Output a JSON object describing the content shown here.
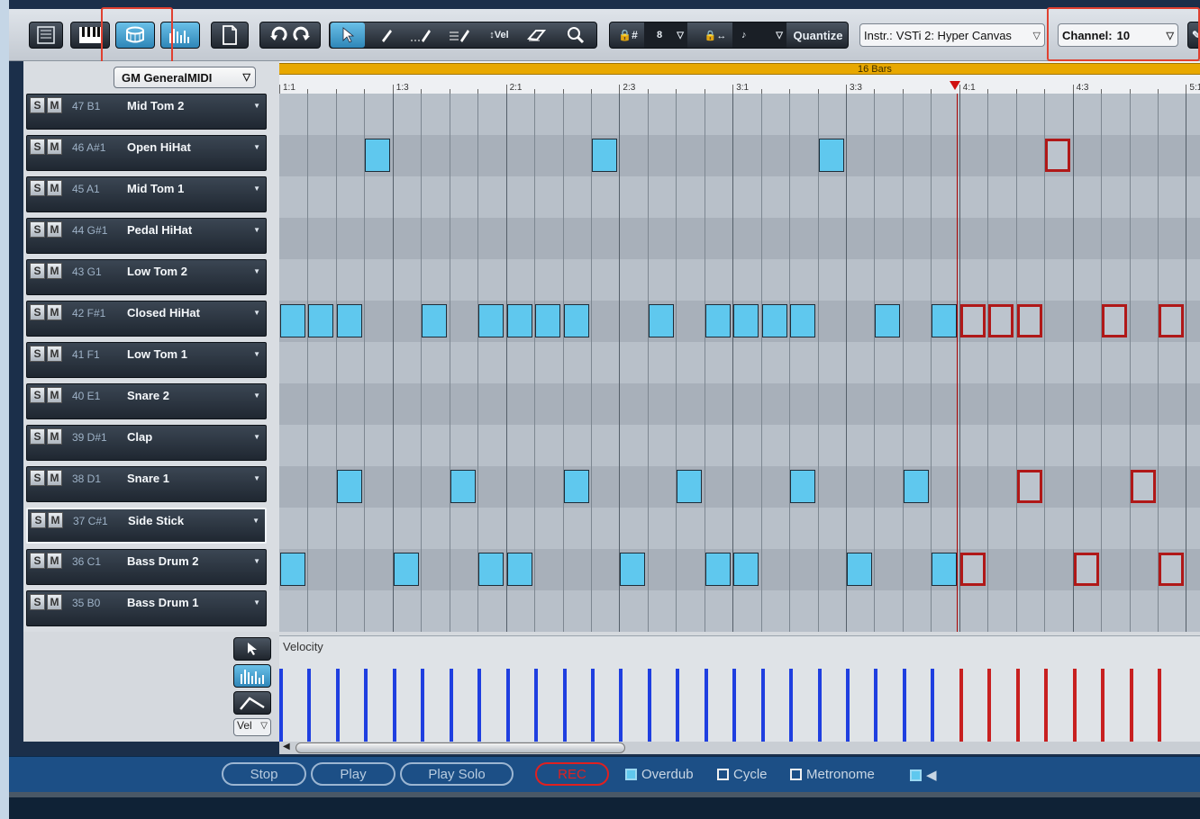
{
  "toolbar": {
    "snap_value": "8",
    "snap_icon": "lock-sharp-icon",
    "length_icon": "lock-arrows-icon",
    "length_value": "♪",
    "quantize_label": "Quantize",
    "velocity_tool_label": "Vel",
    "instrument_label": "Instr.:",
    "instrument_value": "VSTi 2: Hyper Canvas",
    "channel_label": "Channel:",
    "channel_value": "10",
    "highlight_color": "#e04030"
  },
  "drum_map": {
    "preset": "GM GeneralMIDI",
    "solo_label": "S",
    "mute_label": "M",
    "tracks": [
      {
        "note": "47 B1",
        "name": "Mid Tom 2"
      },
      {
        "note": "46 A#1",
        "name": "Open HiHat"
      },
      {
        "note": "45 A1",
        "name": "Mid Tom 1"
      },
      {
        "note": "44 G#1",
        "name": "Pedal HiHat"
      },
      {
        "note": "43 G1",
        "name": "Low Tom 2"
      },
      {
        "note": "42 F#1",
        "name": "Closed HiHat"
      },
      {
        "note": "41 F1",
        "name": "Low Tom 1"
      },
      {
        "note": "40 E1",
        "name": "Snare 2"
      },
      {
        "note": "39 D#1",
        "name": "Clap"
      },
      {
        "note": "38 D1",
        "name": "Snare 1"
      },
      {
        "note": "37 C#1",
        "name": "Side Stick"
      },
      {
        "note": "36 C1",
        "name": "Bass Drum 2"
      },
      {
        "note": "35 B0",
        "name": "Bass Drum 1"
      }
    ]
  },
  "ruler": {
    "marker_label": "16 Bars",
    "labels": [
      "1:1",
      "1:3",
      "2:1",
      "2:3",
      "3:1",
      "3:3",
      "4:1",
      "4:3",
      "5:1"
    ]
  },
  "pattern": {
    "note_color": "#5fc8ee",
    "recorded_color": "#b01818",
    "hits": [
      {
        "lane": 1,
        "steps": [
          3,
          11,
          19
        ],
        "rec_steps": [
          27
        ]
      },
      {
        "lane": 5,
        "steps": [
          0,
          1,
          2,
          5,
          7,
          8,
          9,
          10,
          13,
          15,
          16,
          17,
          18,
          21,
          23
        ],
        "rec_steps": [
          24,
          25,
          26,
          29,
          31
        ]
      },
      {
        "lane": 9,
        "steps": [
          2,
          6,
          10,
          14,
          18,
          22
        ],
        "rec_steps": [
          26,
          30
        ]
      },
      {
        "lane": 11,
        "steps": [
          0,
          4,
          7,
          8,
          12,
          15,
          16,
          20,
          23
        ],
        "rec_steps": [
          24,
          28,
          31
        ]
      }
    ]
  },
  "velocity": {
    "label": "Velocity",
    "select_label": "Vel",
    "count_normal": 24,
    "count_recorded": 8,
    "level": 0.8
  },
  "transport": {
    "stop": "Stop",
    "play": "Play",
    "play_solo": "Play Solo",
    "rec": "REC",
    "overdub": "Overdub",
    "overdub_checked": true,
    "cycle": "Cycle",
    "cycle_checked": false,
    "metronome": "Metronome",
    "metronome_checked": false,
    "speaker_icon": "speaker-icon"
  }
}
